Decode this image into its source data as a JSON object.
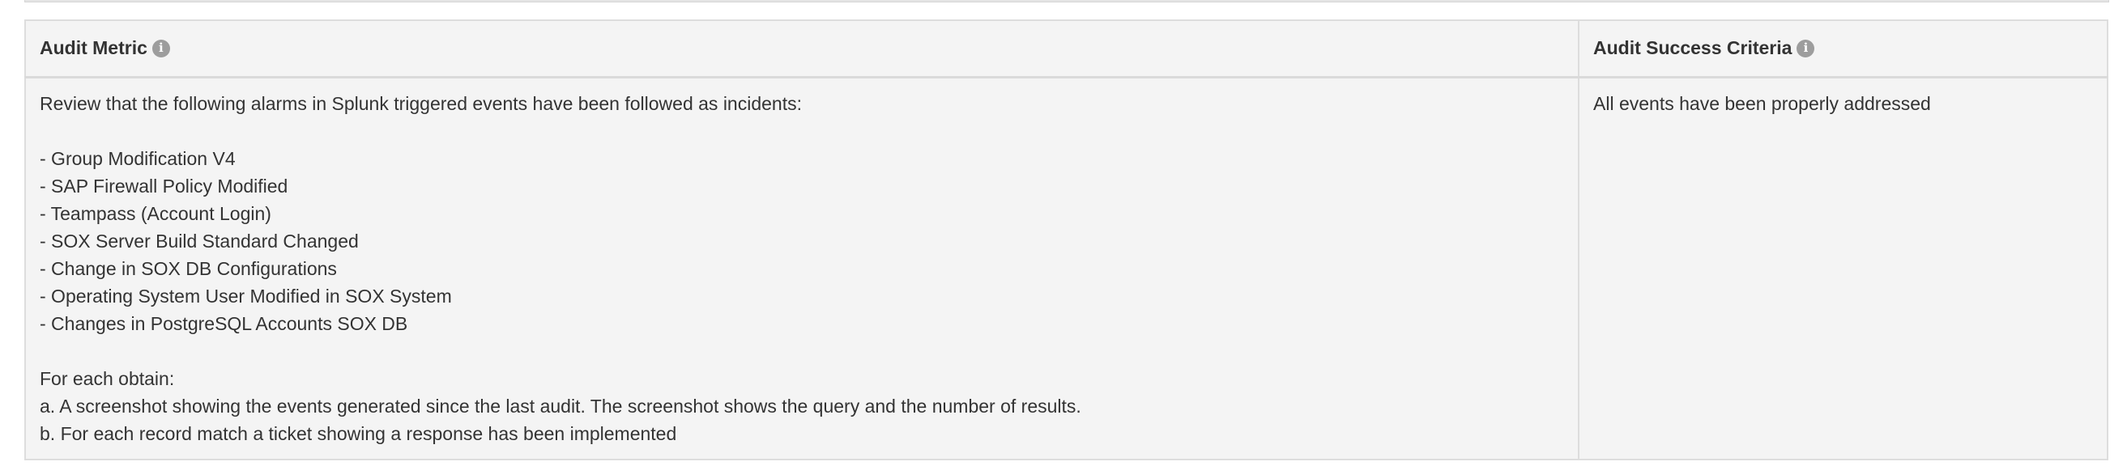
{
  "table": {
    "headers": {
      "metric": "Audit Metric",
      "criteria": "Audit Success Criteria"
    },
    "icons": {
      "metric_info": "info-circle-icon",
      "criteria_info": "info-circle-icon"
    },
    "row": {
      "metric_lines": [
        "Review that the following alarms in Splunk triggered events have been followed as incidents:",
        "",
        "- Group Modification V4",
        "- SAP Firewall Policy Modified",
        "- Teampass (Account Login)",
        "- SOX Server Build Standard Changed",
        "- Change in SOX DB Configurations",
        "- Operating System User Modified in SOX System",
        "- Changes in PostgreSQL Accounts SOX DB",
        "",
        "For each obtain:",
        "a. A screenshot showing the events generated since the last audit. The screenshot shows the query and the number of results.",
        "b. For each record match a ticket showing a response has been implemented"
      ],
      "criteria": "All events have been properly addressed"
    }
  },
  "colors": {
    "table_bg": "#f4f4f4",
    "border": "#dddddd",
    "text": "#333333",
    "info_icon": "#9d9d9d"
  }
}
